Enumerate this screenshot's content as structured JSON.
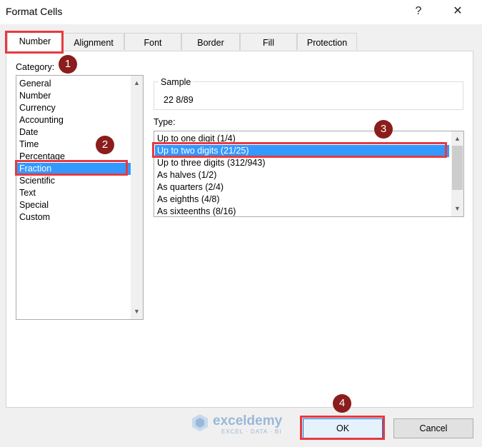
{
  "window": {
    "title": "Format Cells",
    "help_label": "?",
    "close_label": "✕"
  },
  "tabs": [
    {
      "label": "Number",
      "active": true
    },
    {
      "label": "Alignment"
    },
    {
      "label": "Font"
    },
    {
      "label": "Border"
    },
    {
      "label": "Fill"
    },
    {
      "label": "Protection"
    }
  ],
  "category": {
    "label": "Category:",
    "items": [
      "General",
      "Number",
      "Currency",
      "Accounting",
      "Date",
      "Time",
      "Percentage",
      "Fraction",
      "Scientific",
      "Text",
      "Special",
      "Custom"
    ],
    "selected": "Fraction"
  },
  "sample": {
    "label": "Sample",
    "value": "22  8/89"
  },
  "type": {
    "label": "Type:",
    "items": [
      "Up to one digit (1/4)",
      "Up to two digits (21/25)",
      "Up to three digits (312/943)",
      "As halves (1/2)",
      "As quarters (2/4)",
      "As eighths (4/8)",
      "As sixteenths (8/16)"
    ],
    "selected": "Up to two digits (21/25)"
  },
  "buttons": {
    "ok_label": "OK",
    "cancel_label": "Cancel"
  },
  "badges": [
    "1",
    "2",
    "3",
    "4"
  ],
  "watermark": {
    "name": "exceldemy",
    "tagline": "EXCEL · DATA · BI"
  },
  "colors": {
    "selection": "#3399ff",
    "highlight": "#e8393f",
    "badge": "#8b1d1d"
  }
}
